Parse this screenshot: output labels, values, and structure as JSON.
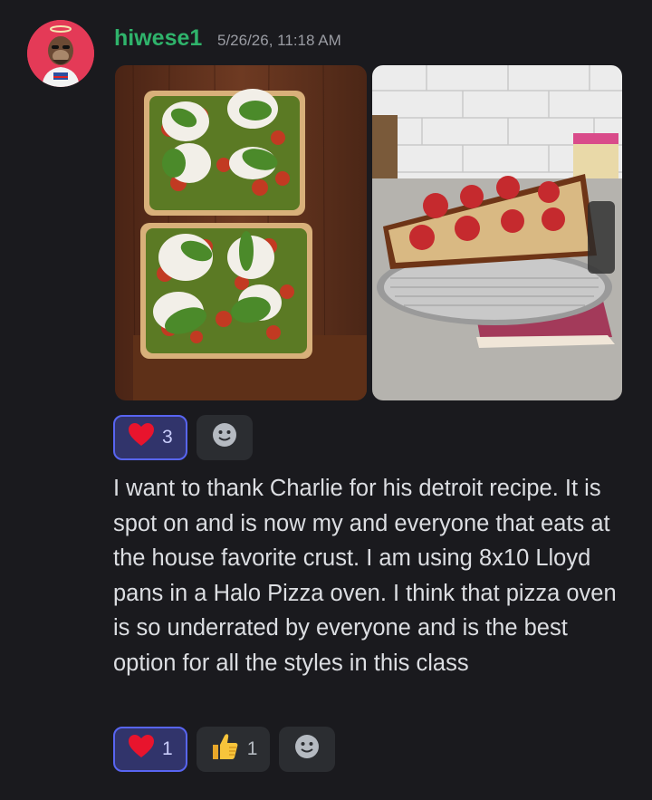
{
  "message": {
    "author": "hiwese1",
    "timestamp": "5/26/26, 11:18 AM",
    "text": "I want to thank Charlie for his detroit recipe. It is spot on and is now my and everyone that eats at the house favorite crust. I am using 8x10 Lloyd pans in a Halo Pizza oven. I think that pizza oven is so underrated by everyone and is the best option for all the styles in this class"
  },
  "image_reactions": [
    {
      "emoji": "red-heart",
      "count": "3"
    }
  ],
  "text_reactions": [
    {
      "emoji": "red-heart",
      "count": "1"
    },
    {
      "emoji": "thumbs-up",
      "count": "1"
    }
  ],
  "colors": {
    "background": "#1a1a1e",
    "username": "#2fb36b",
    "reaction_active_border": "#5865f2"
  }
}
